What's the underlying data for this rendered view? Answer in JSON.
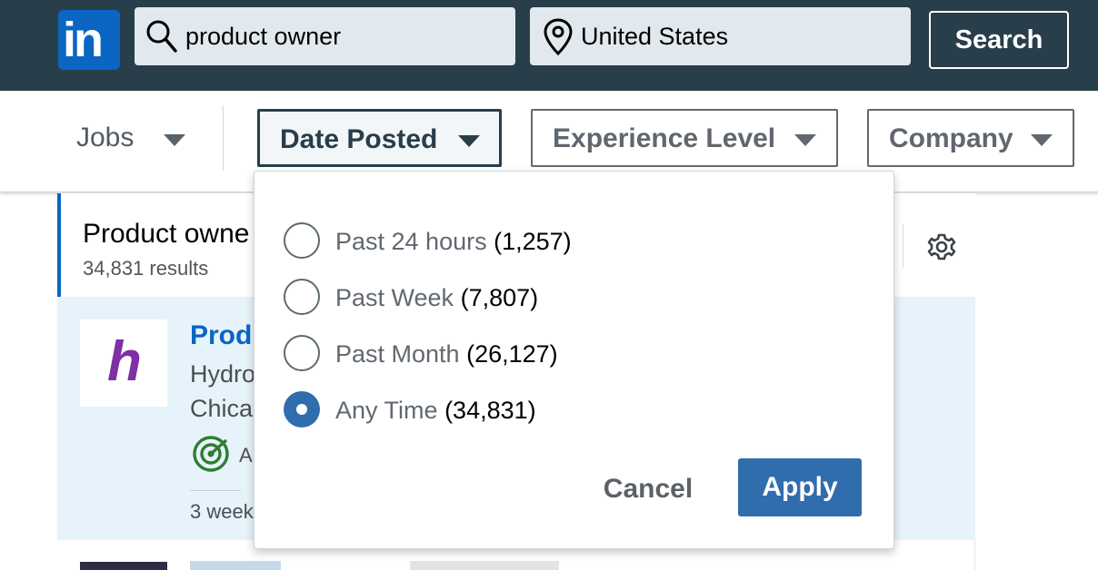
{
  "colors": {
    "header_bg": "#283e4a",
    "brand_blue": "#0a66c2",
    "apply_blue": "#2f6dad",
    "selected_card_bg": "#e7f3fb"
  },
  "header": {
    "logo_text": "in",
    "keywords_value": "product owner",
    "location_value": "United States",
    "search_label": "Search",
    "icons": [
      "search-icon",
      "location-pin-icon"
    ]
  },
  "filters": {
    "jobs_label": "Jobs",
    "date_posted_label": "Date Posted",
    "experience_label": "Experience Level",
    "company_label": "Company"
  },
  "results": {
    "title": "Product owne",
    "count": "34,831 results"
  },
  "job_card": {
    "logo_letter": "h",
    "title": "Prod",
    "company": "Hydro",
    "location": "Chica",
    "badge": "A",
    "posted": "3 week"
  },
  "date_dropdown": {
    "options": [
      {
        "label": "Past 24 hours",
        "count": "(1,257)",
        "selected": false
      },
      {
        "label": "Past Week",
        "count": "(7,807)",
        "selected": false
      },
      {
        "label": "Past Month",
        "count": "(26,127)",
        "selected": false
      },
      {
        "label": "Any Time",
        "count": "(34,831)",
        "selected": true
      }
    ],
    "cancel_label": "Cancel",
    "apply_label": "Apply"
  }
}
